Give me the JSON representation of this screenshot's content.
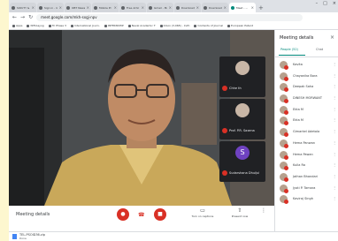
{
  "browser": {
    "tabs": [
      {
        "title": "SIOUTY &"
      },
      {
        "title": "Sign in - G"
      },
      {
        "title": "OBT News"
      },
      {
        "title": "Mobile Pl"
      },
      {
        "title": "Free Artic"
      },
      {
        "title": "Gmail - Mo"
      },
      {
        "title": "Download"
      },
      {
        "title": "Download"
      },
      {
        "title": "Meet - ...",
        "active": true
      }
    ],
    "url": "meet.google.com/mkh-sxgj-npv",
    "bookmarks": [
      "Apps",
      "NITIAayog",
      "Tri Phase 3",
      "International Journ.",
      "INTERNSHIP",
      "Naval Academic T",
      "Inbox (3,068) - Indh",
      "Contents of Journal",
      "European Patent"
    ]
  },
  "meeting": {
    "details_label": "Meeting details",
    "captions_label": "Turn on captions",
    "present_label": "Present now",
    "tiles": [
      {
        "name": "Chhe th",
        "initial": ""
      },
      {
        "name": "Prof. P.R. Saxena",
        "initial": ""
      },
      {
        "name": "Sudarshana Dhuijul",
        "initial": "S"
      }
    ]
  },
  "panel": {
    "title": "Meeting details",
    "people_tab": "People (52)",
    "chat_tab": "Chat",
    "participants": [
      "Kavita",
      "Chayanika Bora",
      "Deepak Saha",
      "DINESH MORWANT",
      "Ekta M",
      "Ekta M",
      "Gimarkel Adetola",
      "Hema Panwan",
      "Hema Pawan",
      "Kulla Ra",
      "Jathan Bhandari",
      "Jyoti P. Tamara",
      "Kaviraj Singh"
    ]
  },
  "download": {
    "file": "TEL-PSOID36.zip",
    "status": "Done"
  }
}
